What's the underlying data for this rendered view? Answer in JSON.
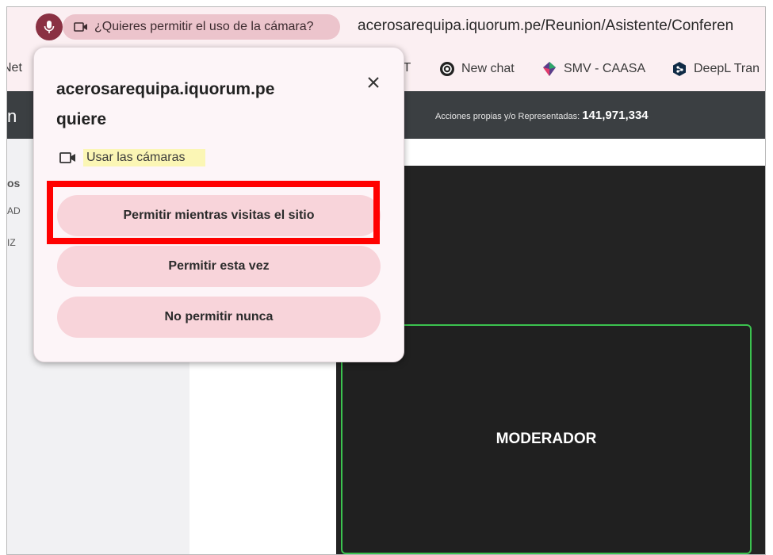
{
  "browser": {
    "camera_prompt": "¿Quieres permitir el uso de la cámara?",
    "url": "acerosarequipa.iquorum.pe/Reunion/Asistente/Conferen"
  },
  "bookmarks": [
    {
      "label": "Net",
      "icon": "globe-icon"
    },
    {
      "label": "AT",
      "icon": ""
    },
    {
      "label": "New chat",
      "icon": "openai-icon"
    },
    {
      "label": "SMV - CAASA",
      "icon": "smv-icon"
    },
    {
      "label": "DeepL Tran",
      "icon": "deepl-icon"
    }
  ],
  "page": {
    "left_header": "n",
    "acciones_label": "Acciones propias y/o Representadas:",
    "acciones_value": "141,971,334",
    "sidebar_partial": [
      "os",
      "AD",
      "IZ"
    ],
    "moderator_label": "MODERADOR"
  },
  "popup": {
    "site": "acerosarequipa.iquorum.pe",
    "quiere": "quiere",
    "camera_use": "Usar las cámaras",
    "buttons": {
      "allow_while_visiting": "Permitir mientras visitas el sitio",
      "allow_once": "Permitir esta vez",
      "never_allow": "No permitir nunca"
    }
  },
  "colors": {
    "accent": "#8a3143",
    "button_bg": "#f8d4da",
    "highlight": "#ff0000",
    "moderator_border": "#3bc24f"
  }
}
